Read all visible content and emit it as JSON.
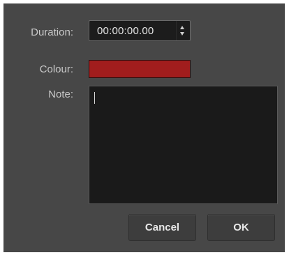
{
  "labels": {
    "duration": "Duration:",
    "colour": "Colour:",
    "note": "Note:"
  },
  "duration": {
    "value": "00:00:00.00"
  },
  "colour": {
    "value": "#a11d1d"
  },
  "note": {
    "value": ""
  },
  "buttons": {
    "cancel": "Cancel",
    "ok": "OK"
  },
  "icons": {
    "stepper_up": "triangle-up",
    "stepper_down": "triangle-down"
  }
}
